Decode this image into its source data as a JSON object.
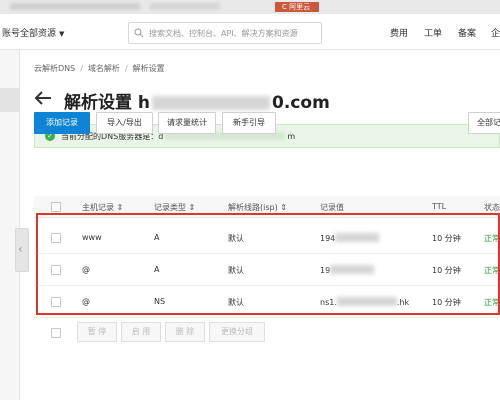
{
  "topbar": {
    "badge": "C 阿里云"
  },
  "navbar": {
    "account": "账号全部资源",
    "search_placeholder": "搜索文档、控制台、API、解决方案和资源",
    "links": [
      "费用",
      "工单",
      "备案",
      "企"
    ]
  },
  "breadcrumb": [
    "云解析DNS",
    "域名解析",
    "解析设置"
  ],
  "page": {
    "title_prefix": "解析设置 h",
    "title_suffix": "0.com"
  },
  "alert": {
    "label": "当前分配的DNS服务器是：",
    "prefix": "d",
    "suffix": "m"
  },
  "toolbar": {
    "add": "添加记录",
    "import": "导入/导出",
    "stats": "请求量统计",
    "guide": "新手引导",
    "all": "全部记"
  },
  "table": {
    "columns": [
      "主机记录",
      "记录类型",
      "解析线路(isp)",
      "记录值",
      "TTL",
      "状态"
    ],
    "rows": [
      {
        "host": "www",
        "type": "A",
        "line": "默认",
        "value_prefix": "194",
        "value_suffix": "",
        "ttl": "10 分钟",
        "status": "正常"
      },
      {
        "host": "@",
        "type": "A",
        "line": "默认",
        "value_prefix": "19",
        "value_suffix": "",
        "ttl": "10 分钟",
        "status": "正常"
      },
      {
        "host": "@",
        "type": "NS",
        "line": "默认",
        "value_prefix": "ns1.",
        "value_suffix": ".hk",
        "ttl": "10 分钟",
        "status": "正常"
      }
    ]
  },
  "bulk": {
    "pause": "暂 停",
    "enable": "启 用",
    "delete": "删 除",
    "group": "更换分组"
  },
  "colors": {
    "primary": "#0e84d6",
    "success": "#2e9a3e",
    "highlight": "#e0352b"
  }
}
